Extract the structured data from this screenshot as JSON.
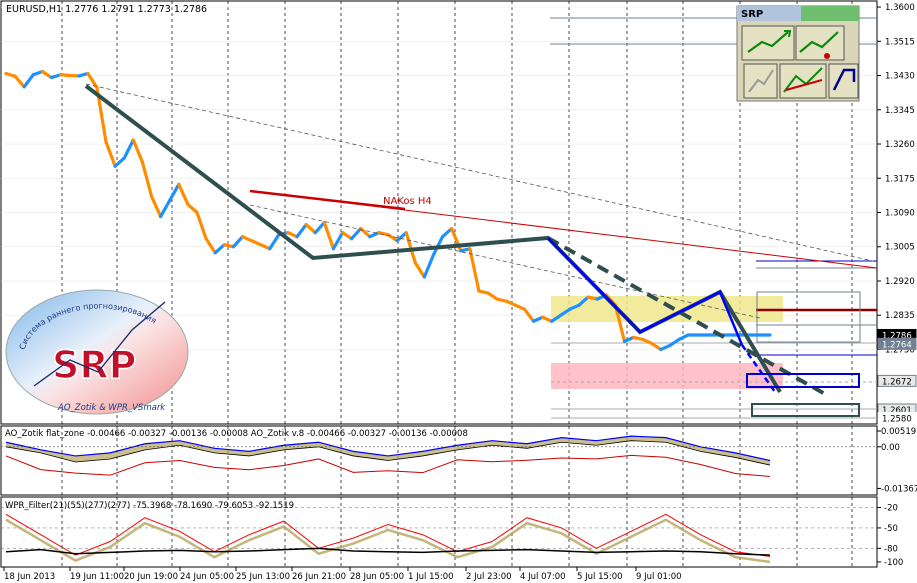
{
  "chart_data": {
    "type": "line",
    "symbol_header": "EURUSD,H1  1.2776  1.2791  1.2773  1.2786",
    "x_labels": [
      "18 Jun 2013",
      "19 Jun 11:00",
      "20 Jun 19:00",
      "24 Jun 05:00",
      "25 Jun 13:00",
      "26 Jun 21:00",
      "28 Jun 05:00",
      "1 Jul 15:00",
      "2 Jul 23:00",
      "4 Jul 07:00",
      "5 Jul 15:00",
      "9 Jul 01:00"
    ],
    "price_axis": {
      "ylim": [
        1.2565,
        1.3615
      ],
      "ticks": [
        "1.3600",
        "1.3515",
        "1.3430",
        "1.3345",
        "1.3260",
        "1.3175",
        "1.3090",
        "1.3005",
        "1.2920",
        "1.2835",
        "1.2750"
      ],
      "tick_values": [
        1.36,
        1.3515,
        1.343,
        1.3345,
        1.326,
        1.3175,
        1.309,
        1.3005,
        1.292,
        1.2835,
        1.275
      ],
      "price_tags": [
        {
          "label": "1.2786",
          "value": 1.2786,
          "style": "current"
        },
        {
          "label": "1.2764",
          "value": 1.2764,
          "style": "grey"
        },
        {
          "label": "1.2672",
          "value": 1.2672,
          "style": "level"
        },
        {
          "label": "1.2601",
          "value": 1.2601,
          "style": "level"
        },
        {
          "label": "1.2580",
          "value": 1.258,
          "style": "faint"
        }
      ]
    },
    "series": [
      {
        "type": "price",
        "x": [
          0,
          3,
          6,
          9,
          12,
          15,
          18,
          21,
          24,
          27,
          30,
          33,
          36,
          39,
          42,
          45,
          48,
          51,
          54,
          57,
          60,
          63,
          66,
          69,
          72,
          75,
          78,
          81,
          84,
          87,
          90,
          93,
          96,
          99,
          102,
          105,
          108,
          111,
          114,
          117,
          120,
          123,
          126,
          129,
          132,
          135,
          138,
          141,
          144,
          147,
          150,
          153,
          156,
          159,
          162,
          165,
          168,
          171,
          174,
          177,
          180,
          183,
          186,
          189,
          192,
          195,
          198,
          201,
          204,
          207,
          210,
          213,
          216,
          219,
          222,
          225,
          228,
          231,
          234,
          237,
          240,
          243,
          246,
          249,
          252
        ],
        "y": [
          1.3435,
          1.3428,
          1.3402,
          1.3432,
          1.344,
          1.3425,
          1.3432,
          1.343,
          1.3429,
          1.3435,
          1.34,
          1.3265,
          1.3205,
          1.3225,
          1.327,
          1.3215,
          1.313,
          1.308,
          1.312,
          1.316,
          1.311,
          1.309,
          1.3025,
          1.299,
          1.301,
          1.3005,
          1.303,
          1.302,
          1.301,
          1.3,
          1.3035,
          1.304,
          1.303,
          1.306,
          1.304,
          1.3065,
          1.3,
          1.304,
          1.3025,
          1.305,
          1.303,
          1.304,
          1.3035,
          1.302,
          1.304,
          1.2965,
          1.293,
          1.2985,
          1.303,
          1.305,
          1.2995,
          1.3,
          1.2895,
          1.289,
          1.2875,
          1.287,
          1.286,
          1.285,
          1.282,
          1.283,
          1.282,
          1.2835,
          1.285,
          1.286,
          1.288,
          1.2875,
          1.2885,
          1.286,
          1.277,
          1.278,
          1.2775,
          1.2765,
          1.275,
          1.276,
          1.2775,
          1.2786,
          1.2786,
          1.2786,
          1.2786,
          1.2786,
          1.2786,
          1.2786,
          1.2786,
          1.2786,
          1.2786
        ],
        "note": "index 0..252 on a linear x scale from first to last visible bar"
      }
    ],
    "annotations": {
      "trend_label": "NAKos H4",
      "panel_title": "SRP",
      "logo_text_top": "Система раннего прогнозирования",
      "logo_text_big": "SRP",
      "logo_text_bottom": "AO_Zotik & WPR_VSmark"
    },
    "indicator_1": {
      "label": "AO_Zotik  flat_zone -0.00466 -0.00327 -0.00136 -0.00008  AO_Zotik v.8 -0.00466 -0.00327 -0.00136 -0.00008",
      "ticks": [
        "0.00519",
        "0.00",
        "-0.01367"
      ],
      "tick_values": [
        0.00519,
        0.0,
        -0.01367
      ],
      "ylim": [
        -0.0155,
        0.0065
      ],
      "signal_line": [
        0.0015,
        -0.001,
        -0.003,
        -0.002,
        0.001,
        0.002,
        -0.0005,
        -0.0015,
        0.0005,
        0.0015,
        -0.0015,
        -0.003,
        -0.0015,
        0.0005,
        0.002,
        0.001,
        0.003,
        0.002,
        0.0035,
        0.003,
        0.0,
        -0.002,
        -0.0045
      ],
      "ao_line": [
        0.0,
        -0.002,
        -0.005,
        -0.004,
        -0.001,
        0.0005,
        -0.002,
        -0.003,
        -0.001,
        0.0,
        -0.003,
        -0.0045,
        -0.003,
        -0.001,
        0.0005,
        -0.0005,
        0.0015,
        0.0005,
        0.002,
        0.0015,
        -0.0015,
        -0.0035,
        -0.006
      ]
    },
    "indicator_2": {
      "label": "WPR_Filter(21)(55)(277)(277) -75.3968 -78.1690 -79.6053 -92.1519",
      "ticks": [
        "-20",
        "-50",
        "-80",
        "-100"
      ],
      "tick_values": [
        -20,
        -50,
        -80,
        -100
      ],
      "ylim": [
        -106,
        -6
      ],
      "wpr_fast": [
        -30,
        -60,
        -90,
        -70,
        -35,
        -55,
        -85,
        -60,
        -40,
        -80,
        -65,
        -45,
        -60,
        -85,
        -70,
        -35,
        -50,
        -80,
        -55,
        -30,
        -60,
        -85,
        -92
      ],
      "wpr_slow": [
        -85,
        -82,
        -88,
        -86,
        -84,
        -83,
        -85,
        -84,
        -82,
        -80,
        -84,
        -85,
        -86,
        -84,
        -83,
        -82,
        -84,
        -86,
        -85,
        -84,
        -85,
        -88,
        -90
      ]
    }
  },
  "colors": {
    "background": "#ffffff",
    "grid": "#000000",
    "price_up": "#1e90ff",
    "price_down": "#ff8c00",
    "trend_main": "#2f4f4f",
    "trend_red": "#cc0000",
    "zigzag": "#0000ff",
    "zone_yellow": "#f0e68c",
    "zone_pink": "#ffb6c1",
    "tag_current": "#000000",
    "tag_level": "#0000cd",
    "ao_fill": "#b5a45a",
    "ao_line": "#cc0000",
    "signal_line": "#0000ff",
    "wpr_fast": "#ff0000",
    "wpr_slow": "#000000"
  }
}
